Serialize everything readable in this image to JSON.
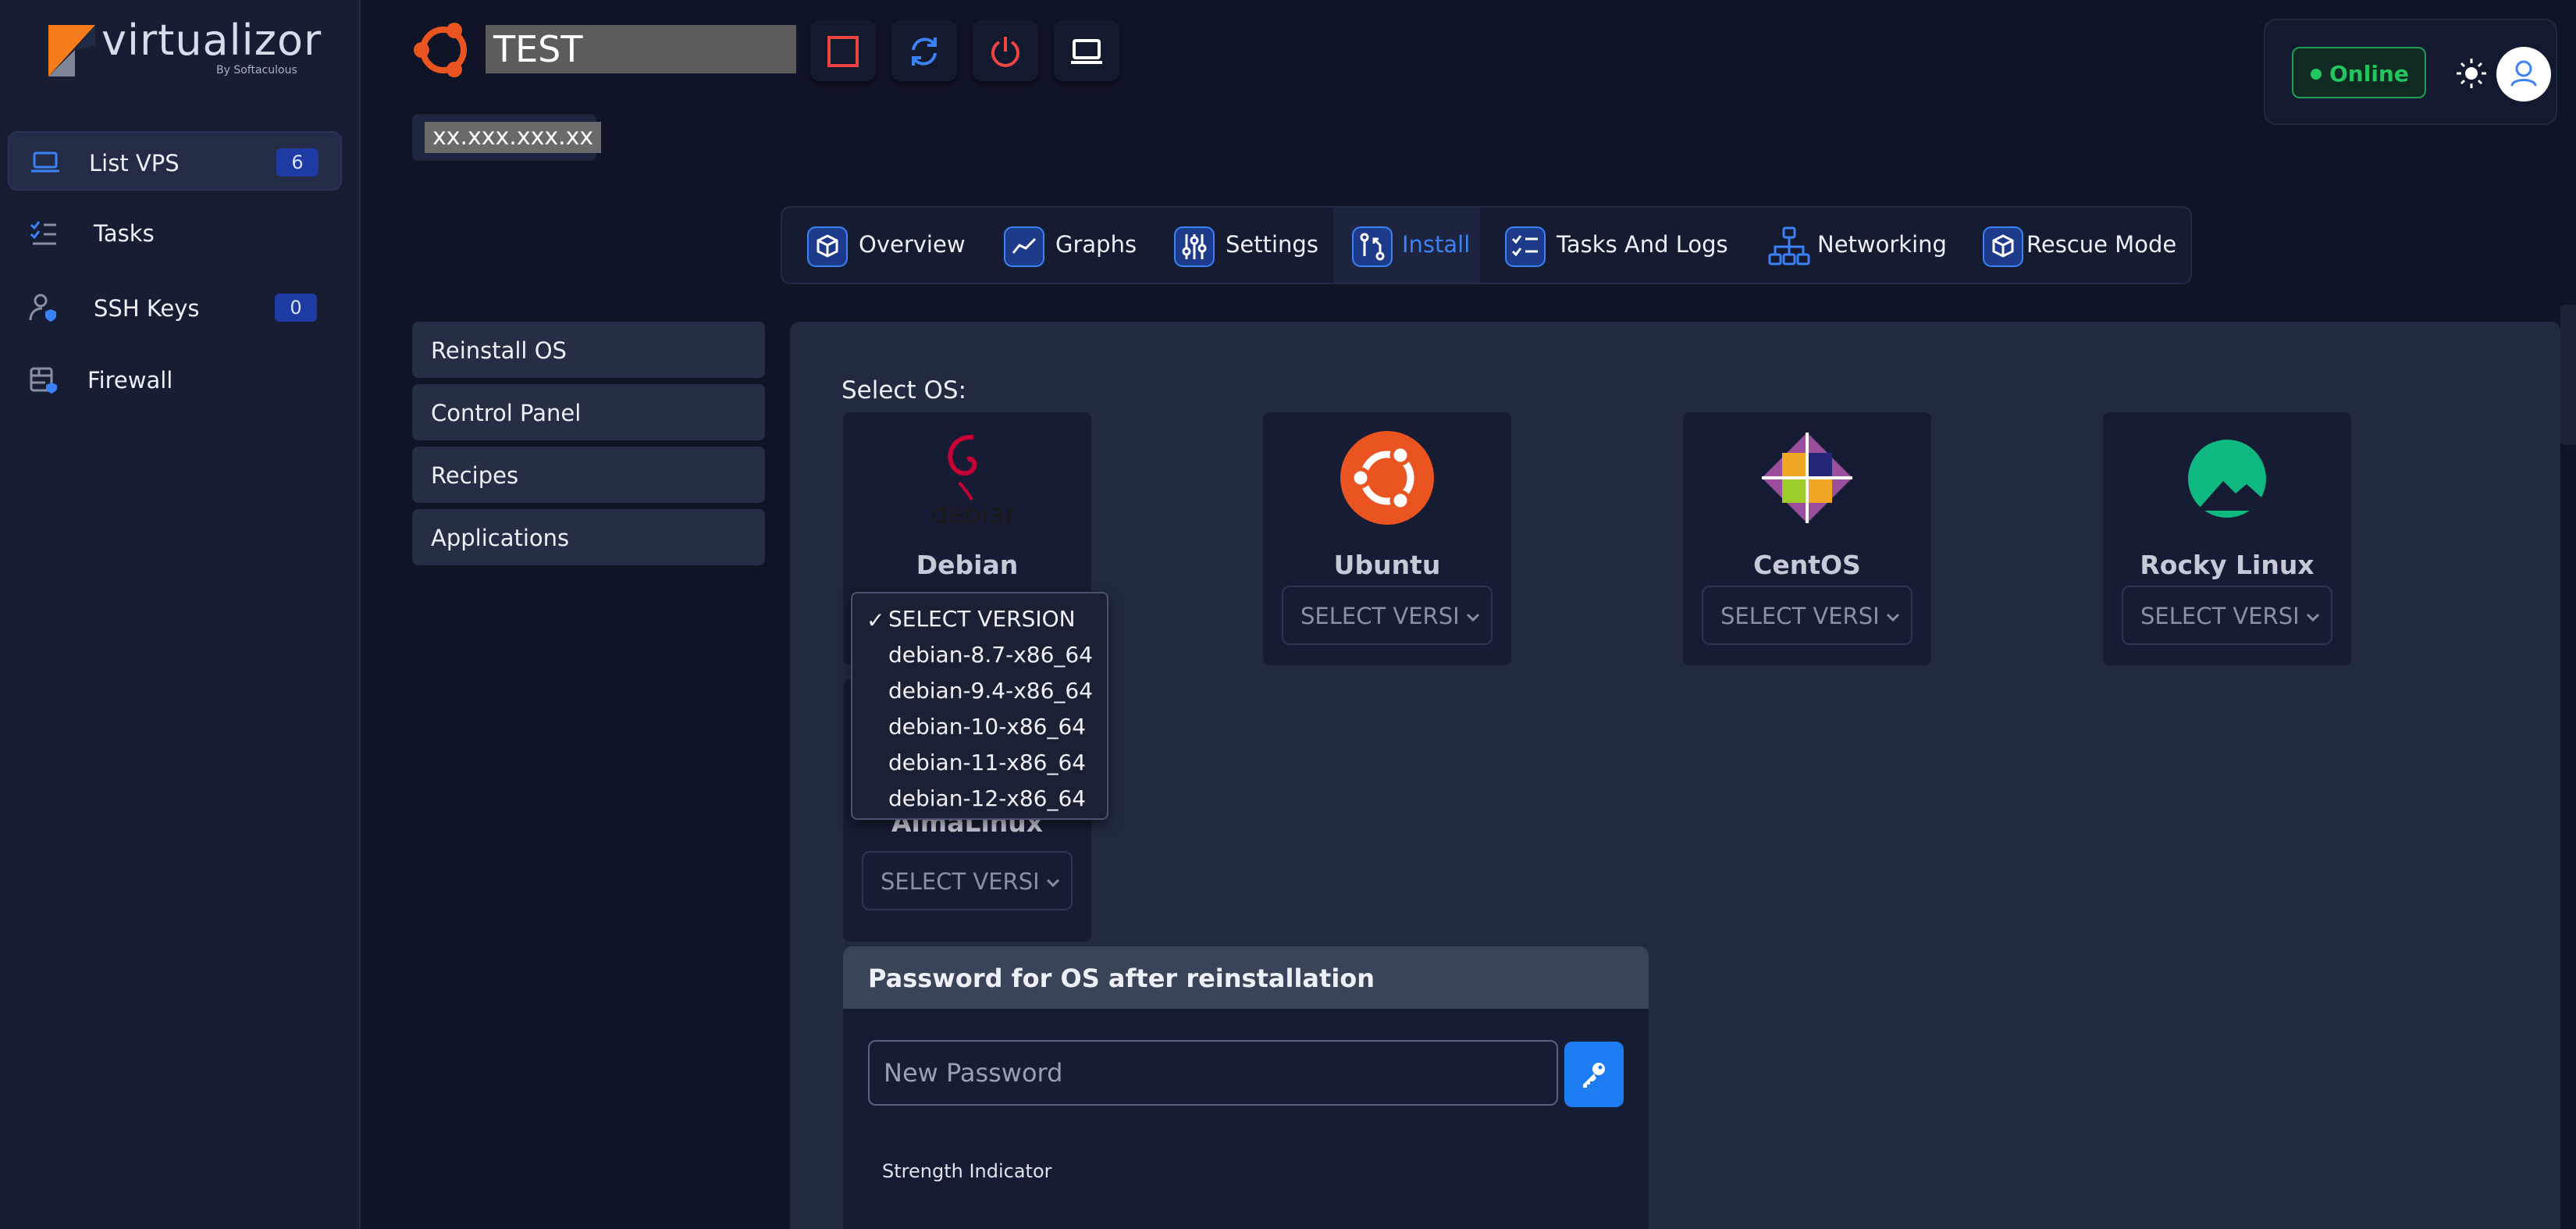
{
  "app": {
    "logo_text": "virtualizor",
    "logo_subtitle": "By Softaculous",
    "brand_color": "#f47c1c",
    "accent_color": "#3b82f6"
  },
  "sidebar": {
    "items": [
      {
        "label": "List VPS",
        "icon": "laptop-icon",
        "badge": "6",
        "active": true
      },
      {
        "label": "Tasks",
        "icon": "checklist-icon"
      },
      {
        "label": "SSH Keys",
        "icon": "user-key-icon",
        "badge": "0"
      },
      {
        "label": "Firewall",
        "icon": "firewall-icon"
      }
    ]
  },
  "header": {
    "vm_name": "TEST",
    "vm_ip": "xx.xxx.xxx.xx",
    "controls": [
      {
        "name": "stop",
        "icon": "stop-icon",
        "color": "#ef4444"
      },
      {
        "name": "restart",
        "icon": "restart-icon",
        "color": "#3b82f6"
      },
      {
        "name": "power-off",
        "icon": "power-icon",
        "color": "#ef4444"
      },
      {
        "name": "vnc",
        "icon": "laptop-icon",
        "color": "#ffffff"
      }
    ],
    "status": "Online",
    "status_color": "#22c55e"
  },
  "tabs": [
    {
      "label": "Overview",
      "icon": "box-icon"
    },
    {
      "label": "Graphs",
      "icon": "graph-icon"
    },
    {
      "label": "Settings",
      "icon": "sliders-icon"
    },
    {
      "label": "Install",
      "icon": "install-icon",
      "active": true
    },
    {
      "label": "Tasks And Logs",
      "icon": "tasklist-icon"
    },
    {
      "label": "Networking",
      "icon": "network-icon"
    },
    {
      "label": "Rescue Mode",
      "icon": "rescue-icon"
    }
  ],
  "install_menu": [
    "Reinstall OS",
    "Control Panel",
    "Recipes",
    "Applications"
  ],
  "main": {
    "select_os_label": "Select OS:",
    "os_list": [
      {
        "name": "Debian",
        "select_value": "SELECT VERSION"
      },
      {
        "name": "Ubuntu",
        "select_value": "SELECT VERSI"
      },
      {
        "name": "CentOS",
        "select_value": "SELECT VERSI"
      },
      {
        "name": "Rocky Linux",
        "select_value": "SELECT VERSI"
      },
      {
        "name": "AlmaLinux",
        "select_value": "SELECT VERSI"
      }
    ],
    "version_dropdown": {
      "options": [
        "SELECT VERSION",
        "debian-8.7-x86_64",
        "debian-9.4-x86_64",
        "debian-10-x86_64",
        "debian-11-x86_64",
        "debian-12-x86_64"
      ],
      "selected": "SELECT VERSION"
    },
    "password": {
      "title": "Password for OS after reinstallation",
      "placeholder": "New Password",
      "strength_label": "Strength Indicator"
    }
  }
}
